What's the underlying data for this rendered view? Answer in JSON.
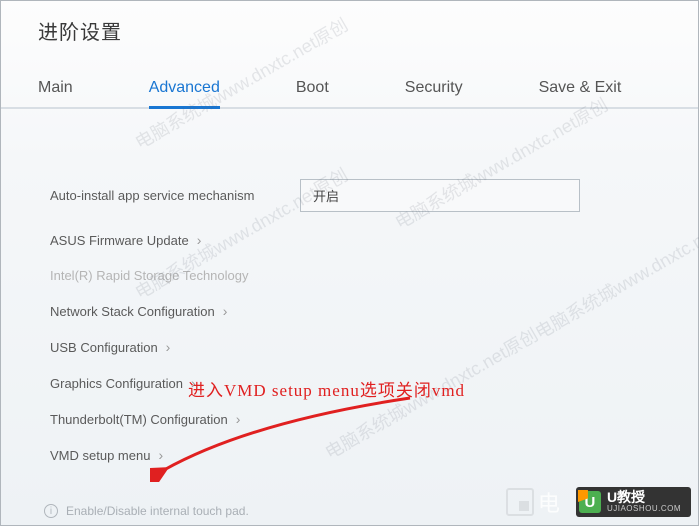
{
  "header": {
    "title": "进阶设置"
  },
  "tabs": {
    "main": "Main",
    "advanced": "Advanced",
    "boot": "Boot",
    "security": "Security",
    "save_exit": "Save & Exit",
    "active": "advanced"
  },
  "settings": {
    "auto_install": {
      "label": "Auto-install app service mechanism",
      "value": "开启"
    },
    "asus_fw": {
      "label": "ASUS Firmware Update"
    },
    "intel_rst": {
      "label": "Intel(R) Rapid Storage Technology"
    },
    "net_stack": {
      "label": "Network Stack Configuration"
    },
    "usb": {
      "label": "USB Configuration"
    },
    "graphics": {
      "label": "Graphics Configuration"
    },
    "thunderbolt": {
      "label": "Thunderbolt(TM) Configuration"
    },
    "vmd": {
      "label": "VMD setup menu"
    }
  },
  "hint": {
    "text": "Enable/Disable internal touch pad."
  },
  "annotation": {
    "text": "进入VMD setup menu选项关闭vmd"
  },
  "watermark": "电脑系统城www.dnxtc.net原创",
  "logos": {
    "dian": "电",
    "ujs_u": "U",
    "ujs_cn": "U教授",
    "ujs_en": "UJIAOSHOU.COM"
  }
}
